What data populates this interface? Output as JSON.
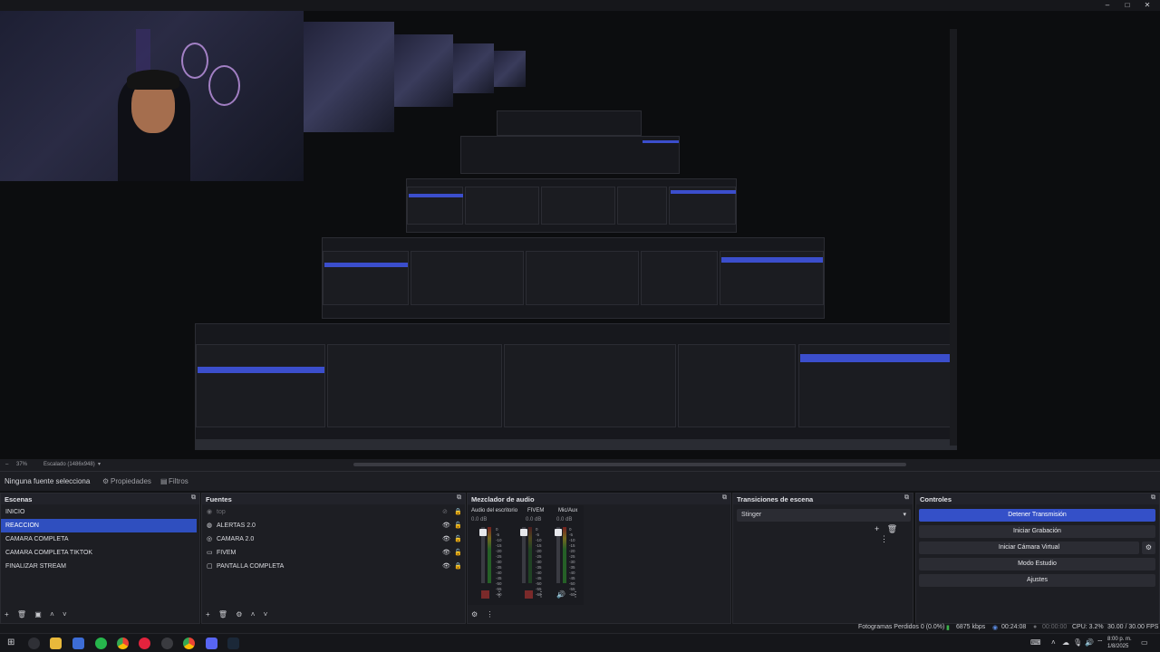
{
  "window": {
    "minimize": "–",
    "maximize": "□",
    "close": "✕"
  },
  "scale_bar": {
    "zoom": "37%",
    "scaling": "Escalado (1486x948)"
  },
  "source_bar": {
    "selection": "Ninguna fuente selecciona",
    "properties": "Propiedades",
    "filters": "Filtros"
  },
  "scenes": {
    "title": "Escenas",
    "items": [
      "INICIO",
      "REACCION",
      "CAMARA COMPLETA",
      "CAMARA COMPLETA TIKTOK",
      "FINALIZAR STREAM"
    ],
    "selected": 1
  },
  "sources": {
    "title": "Fuentes",
    "items": [
      {
        "name": "top",
        "icon": "group-icon",
        "dim": true
      },
      {
        "name": "ALERTAS 2.0",
        "icon": "globe-icon"
      },
      {
        "name": "CAMARA 2.0",
        "icon": "camera-icon"
      },
      {
        "name": "FIVEM",
        "icon": "window-icon"
      },
      {
        "name": "PANTALLA COMPLETA",
        "icon": "monitor-icon"
      }
    ]
  },
  "mixer": {
    "title": "Mezclador de audio",
    "channels": [
      {
        "name": "Audio del escritorio",
        "db": "0.0 dB"
      },
      {
        "name": "FIVEM",
        "db": "0.0 dB"
      },
      {
        "name": "Mic/Aux",
        "db": "0.0 dB"
      }
    ],
    "scale": [
      "0",
      "-5",
      "-10",
      "-15",
      "-20",
      "-25",
      "-30",
      "-35",
      "-40",
      "-45",
      "-50",
      "-55",
      "-60"
    ]
  },
  "transitions": {
    "title": "Transiciones de escena",
    "selected": "Stinger"
  },
  "controls": {
    "title": "Controles",
    "stop_stream": "Detener Transmisión",
    "start_recording": "Iniciar Grabación",
    "virtual_camera": "Iniciar Cámara Virtual",
    "studio_mode": "Modo Estudio",
    "settings": "Ajustes"
  },
  "status": {
    "dropped_frames": "Fotogramas Perdidos 0 (0.0%)",
    "bitrate": "6875 kbps",
    "stream_time": "00:24:08",
    "record_time": "00:00:00",
    "cpu": "CPU: 3.2%",
    "fps": "30.00 / 30.00 FPS"
  },
  "clock": {
    "time": "8:00 p. m.",
    "date": "1/8/2025"
  },
  "colors": {
    "accent": "#3450c8",
    "selected_row": "#2f4fbf",
    "bg": "#1d1e23"
  }
}
